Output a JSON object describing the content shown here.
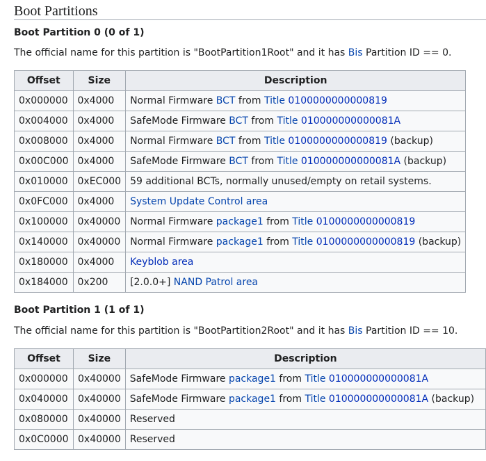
{
  "section": {
    "title": "Boot Partitions"
  },
  "partitions": [
    {
      "heading": "Boot Partition 0 (0 of 1)",
      "para_prefix": "The official name for this partition is \"BootPartition1Root\" and it has ",
      "para_link": "Bis",
      "para_suffix": " Partition ID == 0.",
      "headers": [
        "Offset",
        "Size",
        "Description"
      ],
      "rows": [
        {
          "offset": "0x000000",
          "size": "0x4000",
          "parts": [
            {
              "t": "Normal Firmware "
            },
            {
              "t": "BCT",
              "link": true
            },
            {
              "t": " from "
            },
            {
              "t": "Title",
              "link": true
            },
            {
              "t": " "
            },
            {
              "t": "0100000000000819",
              "link": true,
              "dark": true
            }
          ]
        },
        {
          "offset": "0x004000",
          "size": "0x4000",
          "parts": [
            {
              "t": "SafeMode Firmware "
            },
            {
              "t": "BCT",
              "link": true
            },
            {
              "t": " from "
            },
            {
              "t": "Title",
              "link": true
            },
            {
              "t": " "
            },
            {
              "t": "010000000000081A",
              "link": true,
              "dark": true
            }
          ]
        },
        {
          "offset": "0x008000",
          "size": "0x4000",
          "parts": [
            {
              "t": "Normal Firmware "
            },
            {
              "t": "BCT",
              "link": true
            },
            {
              "t": " from "
            },
            {
              "t": "Title",
              "link": true
            },
            {
              "t": " "
            },
            {
              "t": "0100000000000819",
              "link": true,
              "dark": true
            },
            {
              "t": " (backup)"
            }
          ]
        },
        {
          "offset": "0x00C000",
          "size": "0x4000",
          "parts": [
            {
              "t": "SafeMode Firmware "
            },
            {
              "t": "BCT",
              "link": true
            },
            {
              "t": " from "
            },
            {
              "t": "Title",
              "link": true
            },
            {
              "t": " "
            },
            {
              "t": "010000000000081A",
              "link": true,
              "dark": true
            },
            {
              "t": " (backup)"
            }
          ]
        },
        {
          "offset": "0x010000",
          "size": "0xEC000",
          "parts": [
            {
              "t": "59 additional BCTs, normally unused/empty on retail systems."
            }
          ]
        },
        {
          "offset": "0x0FC000",
          "size": "0x4000",
          "parts": [
            {
              "t": "System Update Control area",
              "link": true
            }
          ]
        },
        {
          "offset": "0x100000",
          "size": "0x40000",
          "parts": [
            {
              "t": "Normal Firmware "
            },
            {
              "t": "package1",
              "link": true
            },
            {
              "t": " from "
            },
            {
              "t": "Title",
              "link": true
            },
            {
              "t": " "
            },
            {
              "t": "0100000000000819",
              "link": true,
              "dark": true
            }
          ]
        },
        {
          "offset": "0x140000",
          "size": "0x40000",
          "parts": [
            {
              "t": "Normal Firmware "
            },
            {
              "t": "package1",
              "link": true
            },
            {
              "t": " from "
            },
            {
              "t": "Title",
              "link": true
            },
            {
              "t": " "
            },
            {
              "t": "0100000000000819",
              "link": true,
              "dark": true
            },
            {
              "t": " (backup)"
            }
          ]
        },
        {
          "offset": "0x180000",
          "size": "0x4000",
          "parts": [
            {
              "t": "Keyblob area",
              "link": true,
              "dark": true
            }
          ]
        },
        {
          "offset": "0x184000",
          "size": "0x200",
          "parts": [
            {
              "t": "[2.0.0+] "
            },
            {
              "t": "NAND Patrol area",
              "link": true
            }
          ]
        }
      ]
    },
    {
      "heading": "Boot Partition 1 (1 of 1)",
      "para_prefix": "The official name for this partition is \"BootPartition2Root\" and it has ",
      "para_link": "Bis",
      "para_suffix": " Partition ID == 10.",
      "headers": [
        "Offset",
        "Size",
        "Description"
      ],
      "rows": [
        {
          "offset": "0x000000",
          "size": "0x40000",
          "parts": [
            {
              "t": "SafeMode Firmware "
            },
            {
              "t": "package1",
              "link": true
            },
            {
              "t": " from "
            },
            {
              "t": "Title",
              "link": true
            },
            {
              "t": " "
            },
            {
              "t": "010000000000081A",
              "link": true,
              "dark": true
            }
          ]
        },
        {
          "offset": "0x040000",
          "size": "0x40000",
          "parts": [
            {
              "t": "SafeMode Firmware "
            },
            {
              "t": "package1",
              "link": true
            },
            {
              "t": " from "
            },
            {
              "t": "Title",
              "link": true
            },
            {
              "t": " "
            },
            {
              "t": "010000000000081A",
              "link": true,
              "dark": true
            },
            {
              "t": " (backup)"
            }
          ]
        },
        {
          "offset": "0x080000",
          "size": "0x40000",
          "parts": [
            {
              "t": "Reserved"
            }
          ]
        },
        {
          "offset": "0x0C0000",
          "size": "0x40000",
          "parts": [
            {
              "t": "Reserved"
            }
          ]
        }
      ]
    }
  ]
}
